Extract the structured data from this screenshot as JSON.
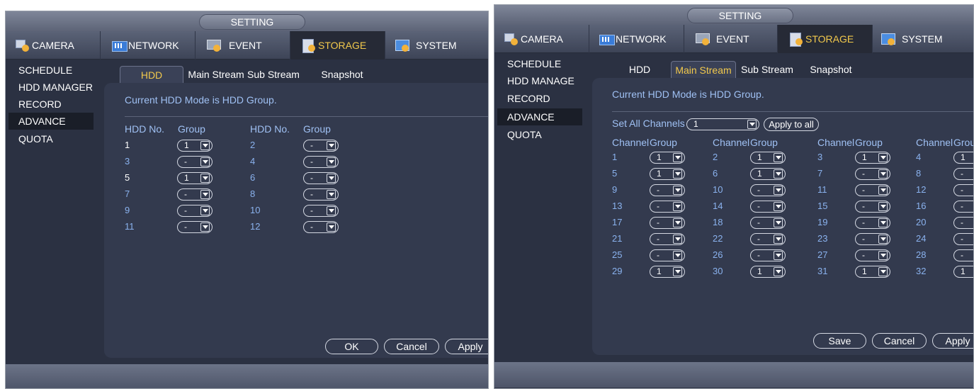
{
  "left": {
    "title": "SETTING",
    "menu": [
      {
        "label": "CAMERA",
        "icon": "camera-icon"
      },
      {
        "label": "NETWORK",
        "icon": "network-icon"
      },
      {
        "label": "EVENT",
        "icon": "event-icon"
      },
      {
        "label": "STORAGE",
        "icon": "storage-icon"
      },
      {
        "label": "SYSTEM",
        "icon": "system-icon"
      }
    ],
    "sidebar": [
      "SCHEDULE",
      "HDD MANAGER",
      "RECORD",
      "ADVANCE",
      "QUOTA"
    ],
    "tabs": [
      "HDD",
      "Main Stream",
      "Sub Stream",
      "Snapshot"
    ],
    "mode_text": "Current HDD Mode is HDD Group.",
    "headers": [
      "HDD No.",
      "Group",
      "HDD No.",
      "Group"
    ],
    "rows": [
      {
        "a": "1",
        "ag": "1",
        "b": "2",
        "bg": "-"
      },
      {
        "a": "3",
        "ag": "-",
        "b": "4",
        "bg": "-"
      },
      {
        "a": "5",
        "ag": "1",
        "b": "6",
        "bg": "-"
      },
      {
        "a": "7",
        "ag": "-",
        "b": "8",
        "bg": "-"
      },
      {
        "a": "9",
        "ag": "-",
        "b": "10",
        "bg": "-"
      },
      {
        "a": "11",
        "ag": "-",
        "b": "12",
        "bg": "-"
      }
    ],
    "buttons": {
      "ok": "OK",
      "cancel": "Cancel",
      "apply": "Apply"
    }
  },
  "right": {
    "title": "SETTING",
    "menu": [
      {
        "label": "CAMERA",
        "icon": "camera-icon"
      },
      {
        "label": "NETWORK",
        "icon": "network-icon"
      },
      {
        "label": "EVENT",
        "icon": "event-icon"
      },
      {
        "label": "STORAGE",
        "icon": "storage-icon"
      },
      {
        "label": "SYSTEM",
        "icon": "system-icon"
      }
    ],
    "sidebar": [
      "SCHEDULE",
      "HDD MANAGE",
      "RECORD",
      "ADVANCE",
      "QUOTA"
    ],
    "tabs": [
      "HDD",
      "Main Stream",
      "Sub Stream",
      "Snapshot"
    ],
    "mode_text": "Current HDD Mode is HDD Group.",
    "set_all_label": "Set All Channels",
    "set_all_value": "1",
    "apply_all": "Apply to all",
    "headers": [
      "Channel",
      "Group",
      "Channel",
      "Group",
      "Channel",
      "Group",
      "Channel",
      "Grou"
    ],
    "rows": [
      [
        [
          "1",
          "1"
        ],
        [
          "2",
          "1"
        ],
        [
          "3",
          "1"
        ],
        [
          "4",
          "1"
        ]
      ],
      [
        [
          "5",
          "1"
        ],
        [
          "6",
          "1"
        ],
        [
          "7",
          "-"
        ],
        [
          "8",
          "-"
        ]
      ],
      [
        [
          "9",
          "-"
        ],
        [
          "10",
          "-"
        ],
        [
          "11",
          "-"
        ],
        [
          "12",
          "-"
        ]
      ],
      [
        [
          "13",
          "-"
        ],
        [
          "14",
          "-"
        ],
        [
          "15",
          "-"
        ],
        [
          "16",
          "-"
        ]
      ],
      [
        [
          "17",
          "-"
        ],
        [
          "18",
          "-"
        ],
        [
          "19",
          "-"
        ],
        [
          "20",
          "-"
        ]
      ],
      [
        [
          "21",
          "-"
        ],
        [
          "22",
          "-"
        ],
        [
          "23",
          "-"
        ],
        [
          "24",
          "-"
        ]
      ],
      [
        [
          "25",
          "-"
        ],
        [
          "26",
          "-"
        ],
        [
          "27",
          "-"
        ],
        [
          "28",
          "-"
        ]
      ],
      [
        [
          "29",
          "1"
        ],
        [
          "30",
          "1"
        ],
        [
          "31",
          "1"
        ],
        [
          "32",
          "1"
        ]
      ]
    ],
    "buttons": {
      "save": "Save",
      "cancel": "Cancel",
      "apply": "Apply"
    }
  },
  "colors": {
    "panel_bg": "#2b3142",
    "content_bg": "#333a4e",
    "accent_yellow": "#f2c94c",
    "text_blue": "#9fc0f3"
  }
}
